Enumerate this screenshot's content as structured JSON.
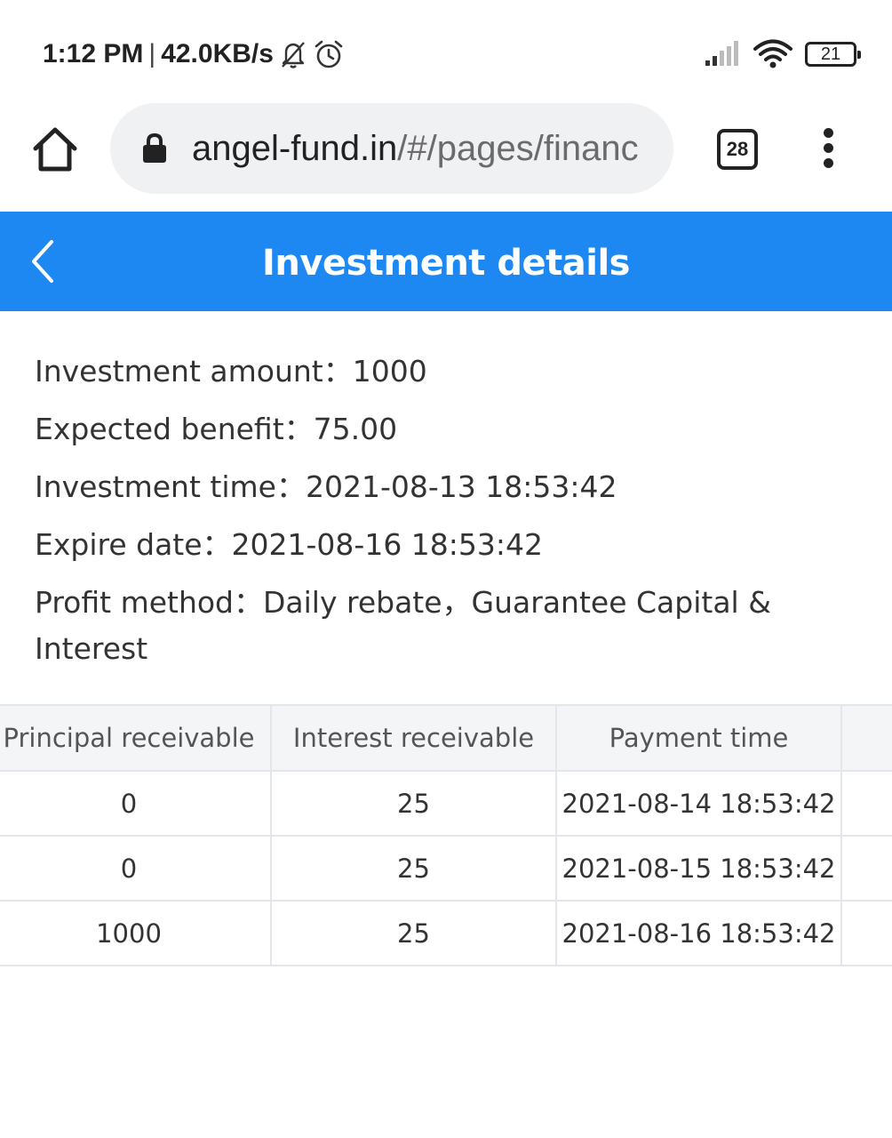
{
  "status_bar": {
    "time": "1:12 PM",
    "separator": "|",
    "speed": "42.0KB/s",
    "battery": "21",
    "icons": [
      "bell-off-icon",
      "alarm-icon",
      "signal-icon",
      "wifi-icon",
      "battery-icon"
    ]
  },
  "browser": {
    "url_host": "angel-fund.in",
    "url_path": "/#/pages/financ",
    "tab_count": "28"
  },
  "header": {
    "title": "Investment details",
    "accent_color": "#1e88f2"
  },
  "details": {
    "investment_amount": "Investment amount：1000",
    "expected_benefit": "Expected benefit：75.00",
    "investment_time": "Investment time：2021-08-13 18:53:42",
    "expire_date": "Expire date：2021-08-16 18:53:42",
    "profit_method": "Profit method：Daily rebate，Guarantee Capital & Interest"
  },
  "table": {
    "headers": [
      "Principal receivable",
      "Interest receivable",
      "Payment time",
      ""
    ],
    "rows": [
      [
        "0",
        "25",
        "2021-08-14 18:53:42",
        ""
      ],
      [
        "0",
        "25",
        "2021-08-15 18:53:42",
        ""
      ],
      [
        "1000",
        "25",
        "2021-08-16 18:53:42",
        ""
      ]
    ]
  }
}
